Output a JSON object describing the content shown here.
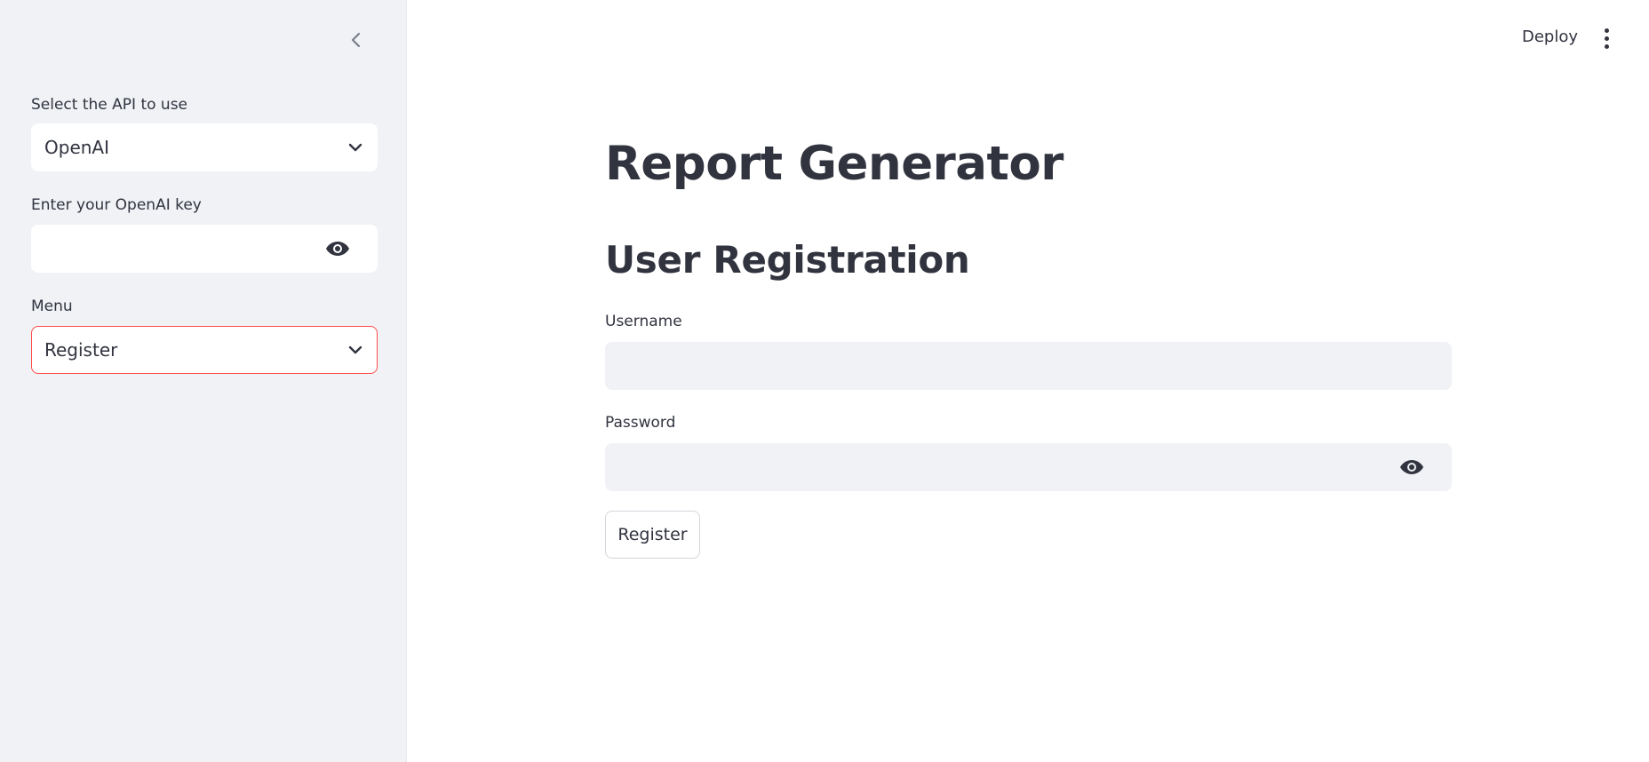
{
  "sidebar": {
    "api_select": {
      "label": "Select the API to use",
      "value": "OpenAI"
    },
    "key_input": {
      "label": "Enter your OpenAI key",
      "value": "",
      "placeholder": ""
    },
    "menu_select": {
      "label": "Menu",
      "value": "Register"
    }
  },
  "header": {
    "deploy_label": "Deploy"
  },
  "main": {
    "title": "Report Generator",
    "subtitle": "User Registration",
    "username": {
      "label": "Username",
      "value": ""
    },
    "password": {
      "label": "Password",
      "value": ""
    },
    "register_button_label": "Register"
  },
  "colors": {
    "sidebar_bg": "#f0f2f6",
    "text": "#31333f",
    "focus_border": "#ff4b4b",
    "input_bg": "#f0f2f6"
  },
  "icons": [
    "chevron-left-icon",
    "chevron-down-icon",
    "eye-icon",
    "kebab-menu-icon"
  ]
}
